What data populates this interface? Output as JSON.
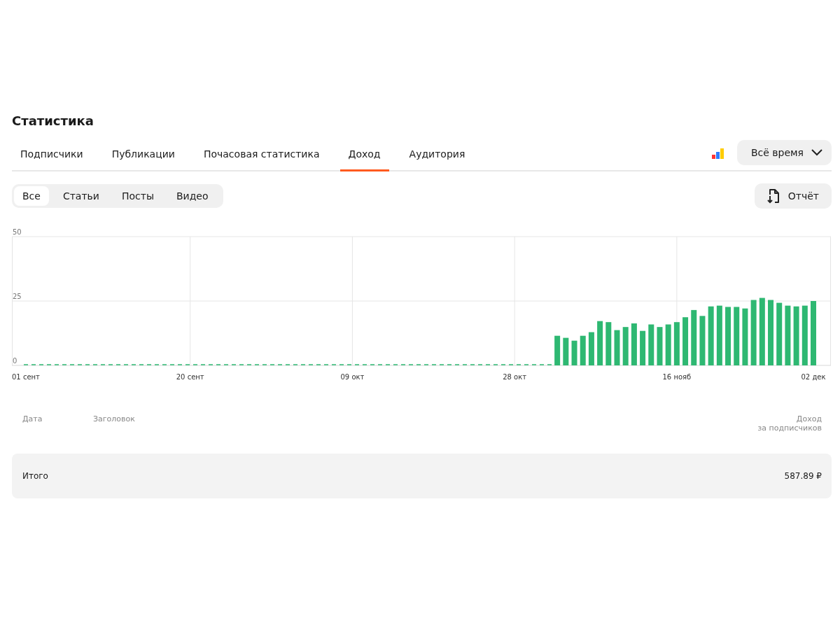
{
  "title": "Статистика",
  "tabs": [
    {
      "label": "Подписчики",
      "selected": false
    },
    {
      "label": "Публикации",
      "selected": false
    },
    {
      "label": "Почасовая статистика",
      "selected": false
    },
    {
      "label": "Доход",
      "selected": true
    },
    {
      "label": "Аудитория",
      "selected": false
    }
  ],
  "period": {
    "label": "Всё время"
  },
  "filters": [
    {
      "label": "Все",
      "selected": true
    },
    {
      "label": "Статьи",
      "selected": false
    },
    {
      "label": "Посты",
      "selected": false
    },
    {
      "label": "Видео",
      "selected": false
    }
  ],
  "report_button": {
    "label": "Отчёт"
  },
  "chart_data": {
    "type": "bar",
    "categories": [
      "01 сент",
      null,
      null,
      null,
      null,
      null,
      null,
      null,
      null,
      null,
      null,
      null,
      null,
      null,
      null,
      null,
      null,
      null,
      null,
      "20 сент",
      null,
      null,
      null,
      null,
      null,
      null,
      null,
      null,
      null,
      null,
      null,
      null,
      null,
      null,
      null,
      null,
      null,
      null,
      "09 окт",
      null,
      null,
      null,
      null,
      null,
      null,
      null,
      null,
      null,
      null,
      null,
      null,
      null,
      null,
      null,
      null,
      null,
      null,
      "28 окт",
      null,
      null,
      null,
      null,
      null,
      null,
      null,
      null,
      null,
      null,
      null,
      null,
      null,
      null,
      null,
      null,
      null,
      null,
      "16 нояб",
      null,
      null,
      null,
      null,
      null,
      null,
      null,
      null,
      null,
      null,
      null,
      null,
      null,
      null,
      null,
      "02 дек"
    ],
    "series": [
      {
        "color": "#2eb872",
        "values": [
          0,
          0,
          0,
          0,
          0,
          0,
          0,
          0,
          0,
          0,
          0,
          0,
          0,
          0,
          0,
          0,
          0,
          0,
          0,
          0,
          0,
          0,
          0,
          0,
          0,
          0,
          0,
          0,
          0,
          0,
          0,
          0,
          0,
          0,
          0,
          0,
          0,
          0,
          0,
          0,
          0,
          0,
          0,
          0,
          0,
          0,
          0,
          0,
          0,
          0,
          0,
          0,
          0,
          0,
          0,
          0,
          0,
          0,
          0,
          0,
          0,
          0,
          11.5,
          10.7,
          9.6,
          11.5,
          12.9,
          17.2,
          16.8,
          13.7,
          14.9,
          16.3,
          13.4,
          15.9,
          14.9,
          15.9,
          16.8,
          18.7,
          21.5,
          19.2,
          22.9,
          23.2,
          22.7,
          22.7,
          22.1,
          25.4,
          26.2,
          25.4,
          24.3,
          23.2,
          22.9,
          23.2,
          25.0
        ]
      }
    ],
    "ylim": [
      0,
      50
    ],
    "yticks": [
      0,
      25,
      50
    ],
    "grid": true
  },
  "table": {
    "columns": [
      {
        "label": "Дата"
      },
      {
        "label": "Заголовок"
      },
      {
        "label": "Доход\nза подписчиков"
      }
    ]
  },
  "total": {
    "label": "Итого",
    "value": "587.89 ₽"
  }
}
